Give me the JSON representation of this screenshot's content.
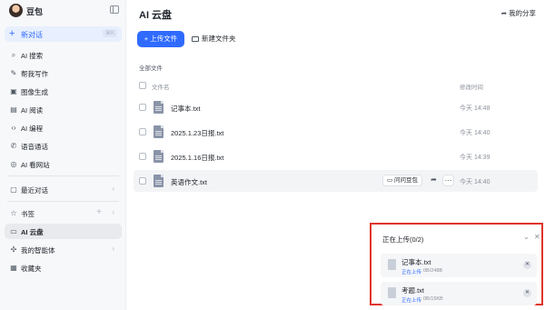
{
  "sidebar": {
    "app_name": "豆包",
    "new_chat": {
      "label": "新对话",
      "shortcut": "⌘K"
    },
    "items": [
      {
        "label": "AI 搜索",
        "icon": "search-icon",
        "glyph": "⌕"
      },
      {
        "label": "帮我写作",
        "icon": "pen-icon",
        "glyph": "✎"
      },
      {
        "label": "图像生成",
        "icon": "image-icon",
        "glyph": "▣"
      },
      {
        "label": "AI 阅读",
        "icon": "book-icon",
        "glyph": "▤"
      },
      {
        "label": "AI 编程",
        "icon": "code-icon",
        "glyph": "‹›"
      },
      {
        "label": "语音通话",
        "icon": "phone-icon",
        "glyph": "✆"
      },
      {
        "label": "AI 看网站",
        "icon": "globe-icon",
        "glyph": "◎"
      }
    ],
    "recent": {
      "label": "最近对话"
    },
    "bottom_items": [
      {
        "label": "书签",
        "icon": "bookmark-icon",
        "glyph": "☆"
      },
      {
        "label": "AI 云盘",
        "icon": "cloud-drive-icon",
        "glyph": "▭"
      },
      {
        "label": "我的智能体",
        "icon": "agent-icon",
        "glyph": "✣"
      },
      {
        "label": "收藏夹",
        "icon": "favorites-icon",
        "glyph": "▦"
      }
    ]
  },
  "main": {
    "title": "AI 云盘",
    "share_label": "我的分享",
    "upload_button": "+ 上传文件",
    "new_folder_button": "新建文件夹",
    "section_label": "全部文件",
    "columns": {
      "name": "文件名",
      "modified": "修改时间"
    },
    "files": [
      {
        "name": "记事本.txt",
        "time": "今天 14:48"
      },
      {
        "name": "2025.1.23日报.txt",
        "time": "今天 14:40"
      },
      {
        "name": "2025.1.16日报.txt",
        "time": "今天 14:39"
      },
      {
        "name": "英语作文.txt",
        "time": "今天 14:40",
        "ask_label": "问问豆包"
      }
    ]
  },
  "upload_panel": {
    "title": "正在上传(0/2)",
    "items": [
      {
        "name": "记事本.txt",
        "status": "正在上传",
        "progress": "0B/248B",
        "fraction": 0
      },
      {
        "name": "考题.txt",
        "status": "正在上传",
        "progress": "0B/15KB",
        "fraction": 0
      }
    ]
  },
  "colors": {
    "accent": "#2f6bff",
    "highlight_border": "#e0342a"
  }
}
